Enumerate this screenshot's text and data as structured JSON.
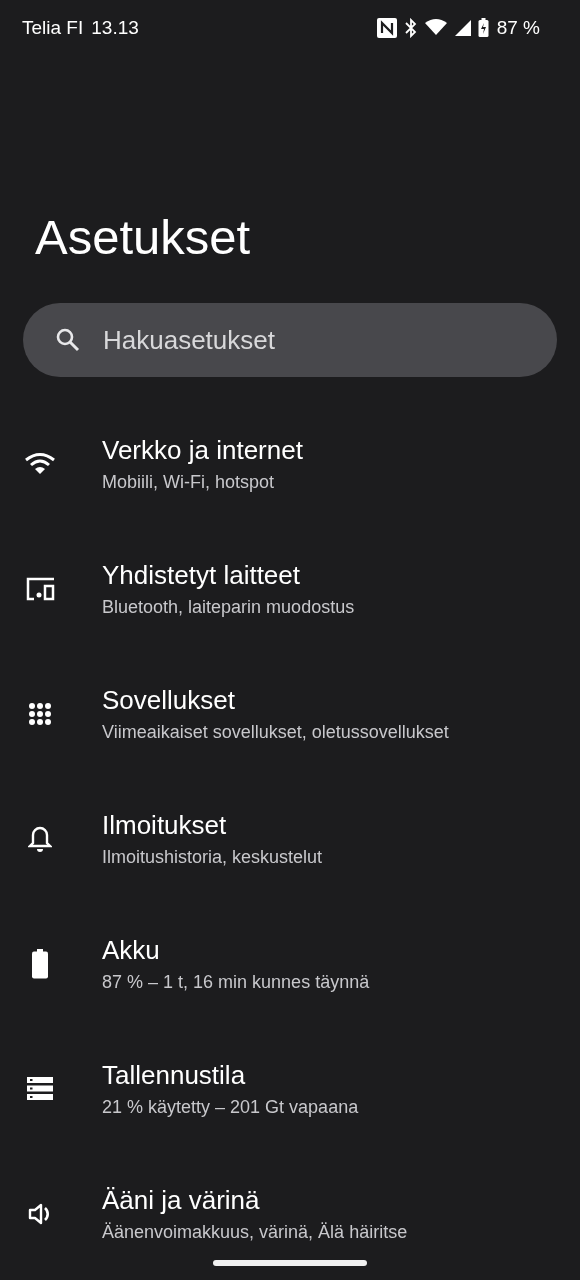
{
  "status_bar": {
    "carrier": "Telia FI",
    "time": "13.13",
    "battery": "87 %"
  },
  "title": "Asetukset",
  "search": {
    "placeholder": "Hakuasetukset"
  },
  "items": [
    {
      "kind": "wifi",
      "title": "Verkko ja internet",
      "subtitle": "Mobiili, Wi-Fi, hotspot"
    },
    {
      "kind": "devices",
      "title": "Yhdistetyt laitteet",
      "subtitle": "Bluetooth, laiteparin muodostus"
    },
    {
      "kind": "apps",
      "title": "Sovellukset",
      "subtitle": "Viimeaikaiset sovellukset, oletussovellukset"
    },
    {
      "kind": "bell",
      "title": "Ilmoitukset",
      "subtitle": "Ilmoitushistoria, keskustelut"
    },
    {
      "kind": "battery",
      "title": "Akku",
      "subtitle": "87 % – 1 t, 16 min kunnes täynnä"
    },
    {
      "kind": "storage",
      "title": "Tallennustila",
      "subtitle": "21 % käytetty – 201 Gt vapaana"
    },
    {
      "kind": "sound",
      "title": "Ääni ja värinä",
      "subtitle": "Äänenvoimakkuus, värinä, Älä häiritse"
    }
  ]
}
